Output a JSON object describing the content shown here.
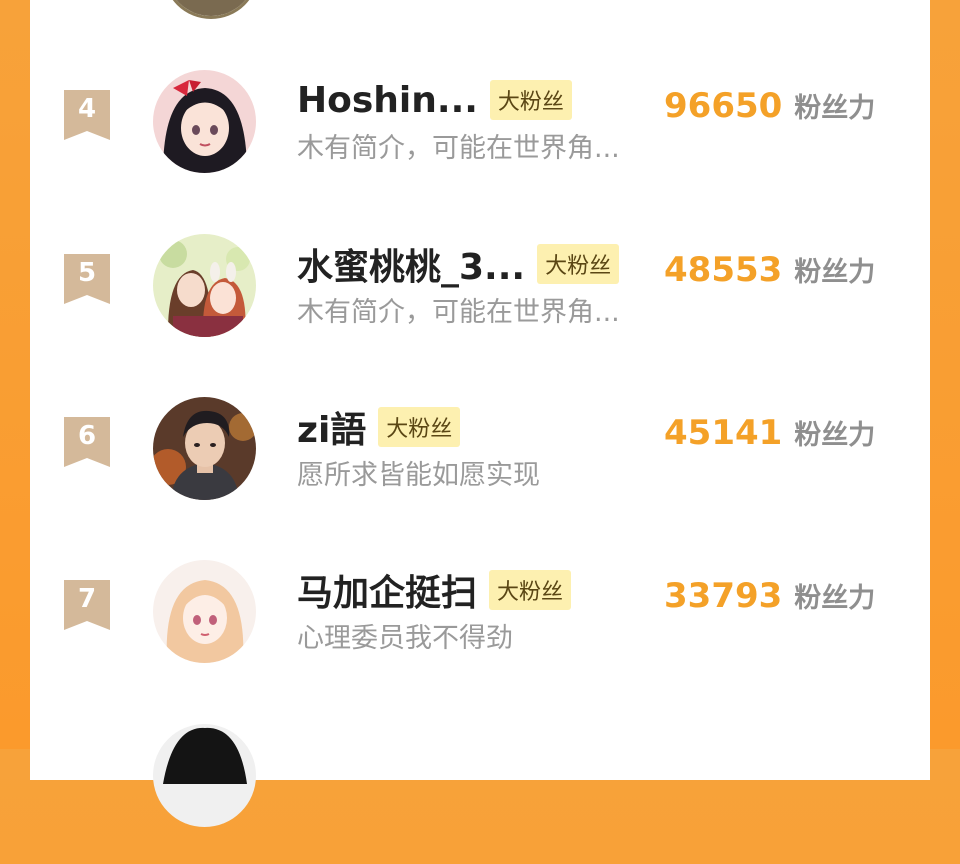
{
  "ranking": {
    "score_unit": "粉丝力",
    "entries": [
      {
        "rank": "4",
        "name": "Hoshin...",
        "badge": "大粉丝",
        "bio": "木有简介，可能在世界角...",
        "score": "96650",
        "avatar_icon": "anime-girl-red-bow-avatar"
      },
      {
        "rank": "5",
        "name": "水蜜桃桃_3...",
        "badge": "大粉丝",
        "bio": "木有简介，可能在世界角...",
        "score": "48553",
        "avatar_icon": "anime-couple-avatar"
      },
      {
        "rank": "6",
        "name": "zi語",
        "badge": "大粉丝",
        "bio": "愿所求皆能如愿实现",
        "score": "45141",
        "avatar_icon": "anime-man-avatar"
      },
      {
        "rank": "7",
        "name": "马加企挺扫",
        "badge": "大粉丝",
        "bio": "心理委员我不得劲",
        "score": "33793",
        "avatar_icon": "anime-girl-pastel-avatar"
      },
      {
        "rank": "",
        "name": "",
        "badge": "",
        "bio": "",
        "score": "",
        "avatar_icon": "anime-boy-dark-hair-avatar"
      }
    ]
  },
  "colors": {
    "background": "#f7a23a",
    "score": "#f4a128",
    "badge_bg": "#fdf0b0",
    "rank_badge": "#d4b99a"
  }
}
